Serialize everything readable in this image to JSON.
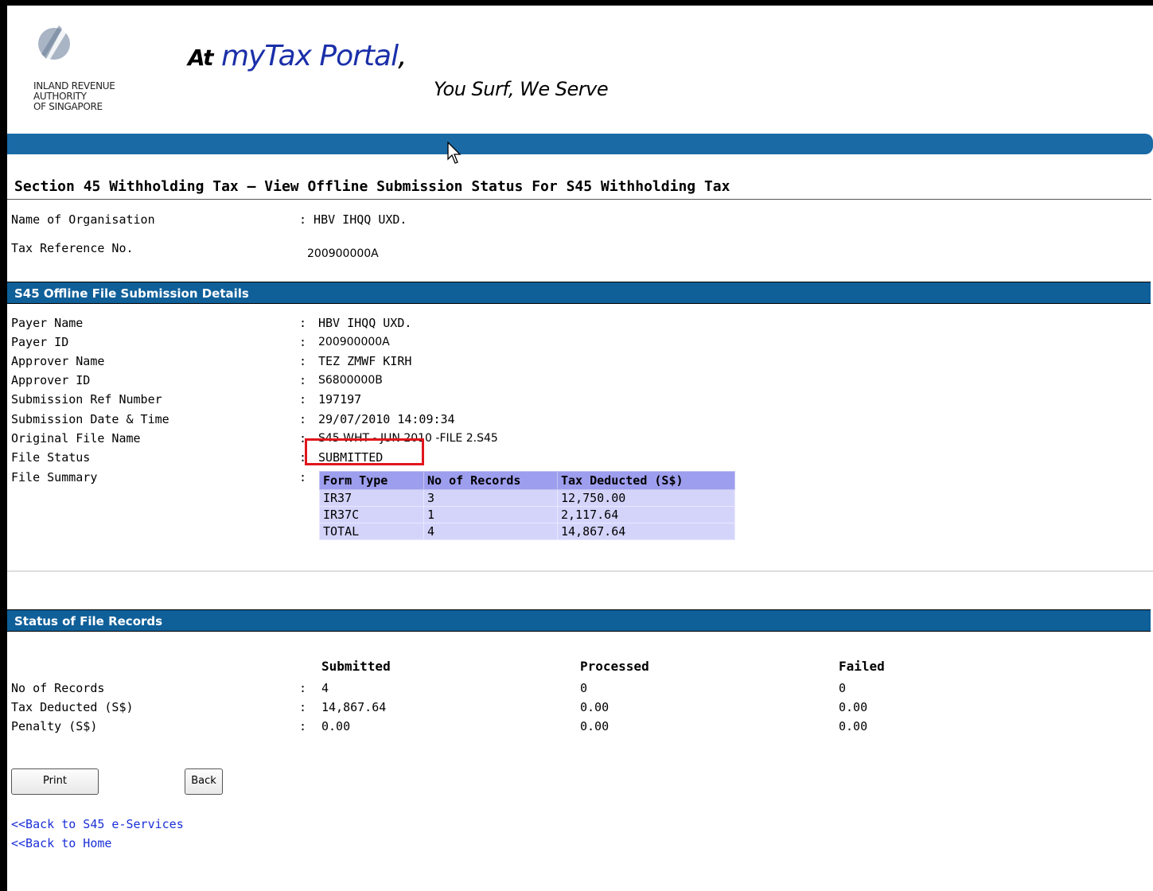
{
  "header": {
    "org_lines": [
      "INLAND REVENUE",
      "AUTHORITY",
      "OF SINGAPORE"
    ],
    "tagline_at": "At",
    "tagline_brand": "myTax Portal",
    "tagline_comma": ",",
    "slogan": "You Surf, We Serve"
  },
  "page_title": "Section 45 Withholding Tax – View Offline Submission Status For S45 Withholding Tax",
  "org_info": {
    "name_label": "Name of Organisation",
    "name_value": ": HBV IHQQ UXD.",
    "taxref_label": "Tax Reference No.",
    "taxref_value": "200900000A"
  },
  "submission": {
    "section_title": "S45 Offline File Submission Details",
    "fields": [
      {
        "label": "Payer Name",
        "value": "HBV IHQQ UXD."
      },
      {
        "label": "Payer ID",
        "value": "200900000A"
      },
      {
        "label": "Approver Name",
        "value": "TEZ ZMWF KIRH"
      },
      {
        "label": "Approver ID",
        "value": "S6800000B"
      },
      {
        "label": "Submission Ref Number",
        "value": "197197"
      },
      {
        "label": "Submission Date & Time",
        "value": "29/07/2010 14:09:34"
      },
      {
        "label": "Original File Name",
        "value": "S45 WHT - JUN 2010 -FILE 2.S45"
      },
      {
        "label": "File Status",
        "value": "SUBMITTED"
      },
      {
        "label": "File Summary",
        "value": ""
      }
    ],
    "summary_table": {
      "headers": [
        "Form Type",
        "No of Records",
        "Tax Deducted (S$)"
      ],
      "rows": [
        [
          "IR37",
          "3",
          "12,750.00"
        ],
        [
          "IR37C",
          "1",
          "2,117.64"
        ],
        [
          "TOTAL",
          "4",
          "14,867.64"
        ]
      ]
    }
  },
  "status": {
    "section_title": "Status of File Records",
    "columns": [
      "Submitted",
      "Processed",
      "Failed"
    ],
    "rows": [
      {
        "label": "No of Records",
        "values": [
          "4",
          "0",
          "0"
        ]
      },
      {
        "label": "Tax Deducted (S$)",
        "values": [
          "14,867.64",
          "0.00",
          "0.00"
        ]
      },
      {
        "label": "Penalty (S$)",
        "values": [
          "0.00",
          "0.00",
          "0.00"
        ]
      }
    ]
  },
  "buttons": {
    "print": "Print",
    "back": "Back"
  },
  "links": {
    "back_s45": "<<Back to S45 e-Services",
    "back_home": "<<Back to Home"
  },
  "colors": {
    "bar": "#1a6aa6",
    "section": "#0f5f99",
    "highlight": "#e0161c",
    "link": "#1a2fd8"
  }
}
